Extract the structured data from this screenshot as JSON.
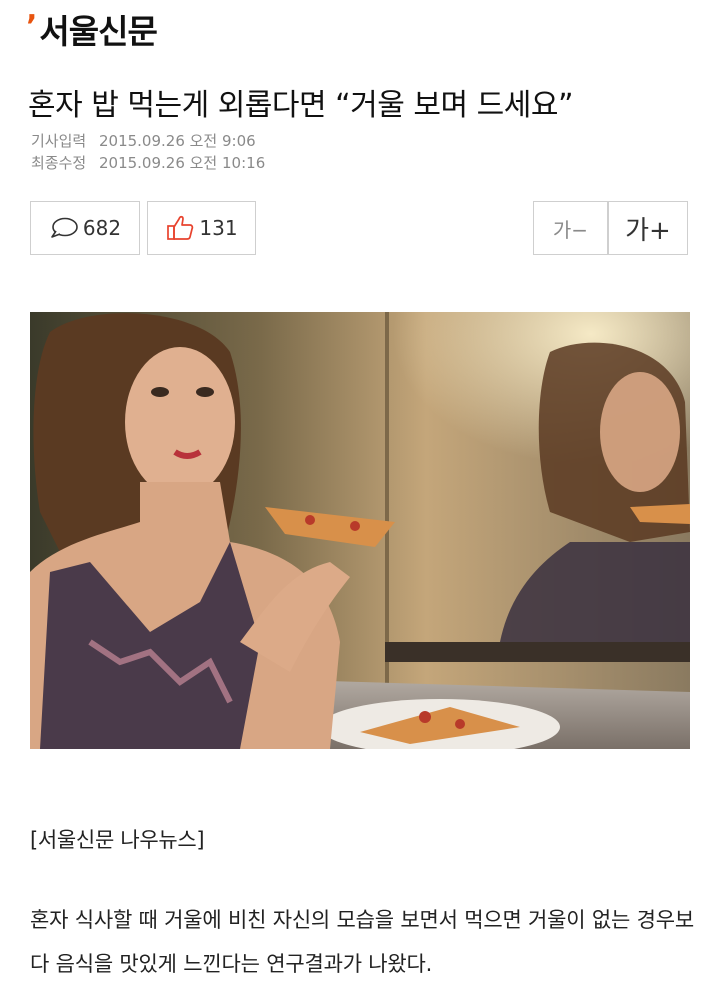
{
  "logo": {
    "text": "서울신문",
    "accent_color": "#e8540f"
  },
  "article": {
    "headline": "혼자 밥 먹는게 외롭다면 “거울 보며 드세요”",
    "input_label": "기사입력",
    "input_date": "2015.09.26 오전 9:06",
    "modified_label": "최종수정",
    "modified_date": "2015.09.26 오전 10:16",
    "byline": "[서울신문 나우뉴스]",
    "body": "혼자 식사할 때 거울에 비친 자신의 모습을 보면서 먹으면 거울이 없는 경우보다 음식을 맛있게 느낀다는 연구결과가 나왔다."
  },
  "toolbar": {
    "comment_count": "682",
    "like_count": "131",
    "like_color": "#e8432e",
    "font_decrease": "가−",
    "font_increase": "가+"
  },
  "image": {
    "alt": "woman eating pizza in front of a mirror"
  }
}
